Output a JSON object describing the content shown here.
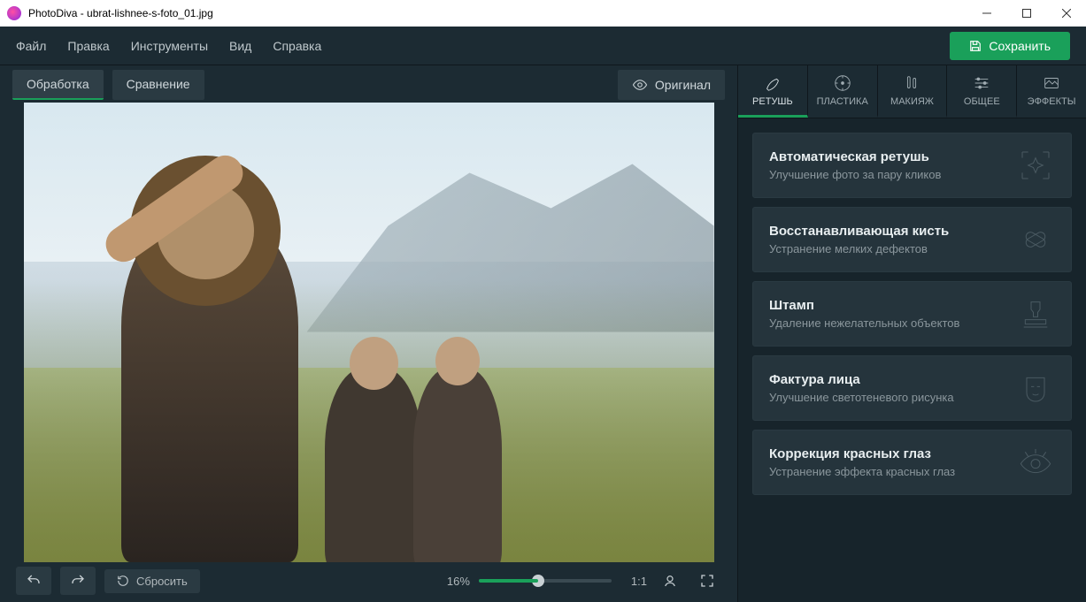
{
  "window": {
    "title": "PhotoDiva - ubrat-lishnee-s-foto_01.jpg"
  },
  "menu": {
    "file": "Файл",
    "edit": "Правка",
    "tools": "Инструменты",
    "view": "Вид",
    "help": "Справка"
  },
  "save_label": "Сохранить",
  "top_tabs": {
    "edit": "Обработка",
    "compare": "Сравнение"
  },
  "original_label": "Оригинал",
  "bottom": {
    "reset": "Сбросить",
    "zoom": "16%",
    "ratio": "1:1"
  },
  "side_tabs": {
    "retouch": "РЕТУШЬ",
    "plastika": "ПЛАСТИКА",
    "makeup": "МАКИЯЖ",
    "common": "ОБЩЕЕ",
    "effects": "ЭФФЕКТЫ"
  },
  "tools": {
    "auto": {
      "title": "Автоматическая ретушь",
      "desc": "Улучшение фото за пару кликов"
    },
    "heal": {
      "title": "Восстанавливающая кисть",
      "desc": "Устранение мелких дефектов"
    },
    "stamp": {
      "title": "Штамп",
      "desc": "Удаление нежелательных объектов"
    },
    "face": {
      "title": "Фактура лица",
      "desc": "Улучшение светотеневого рисунка"
    },
    "redeye": {
      "title": "Коррекция красных глаз",
      "desc": "Устранение эффекта красных глаз"
    }
  }
}
